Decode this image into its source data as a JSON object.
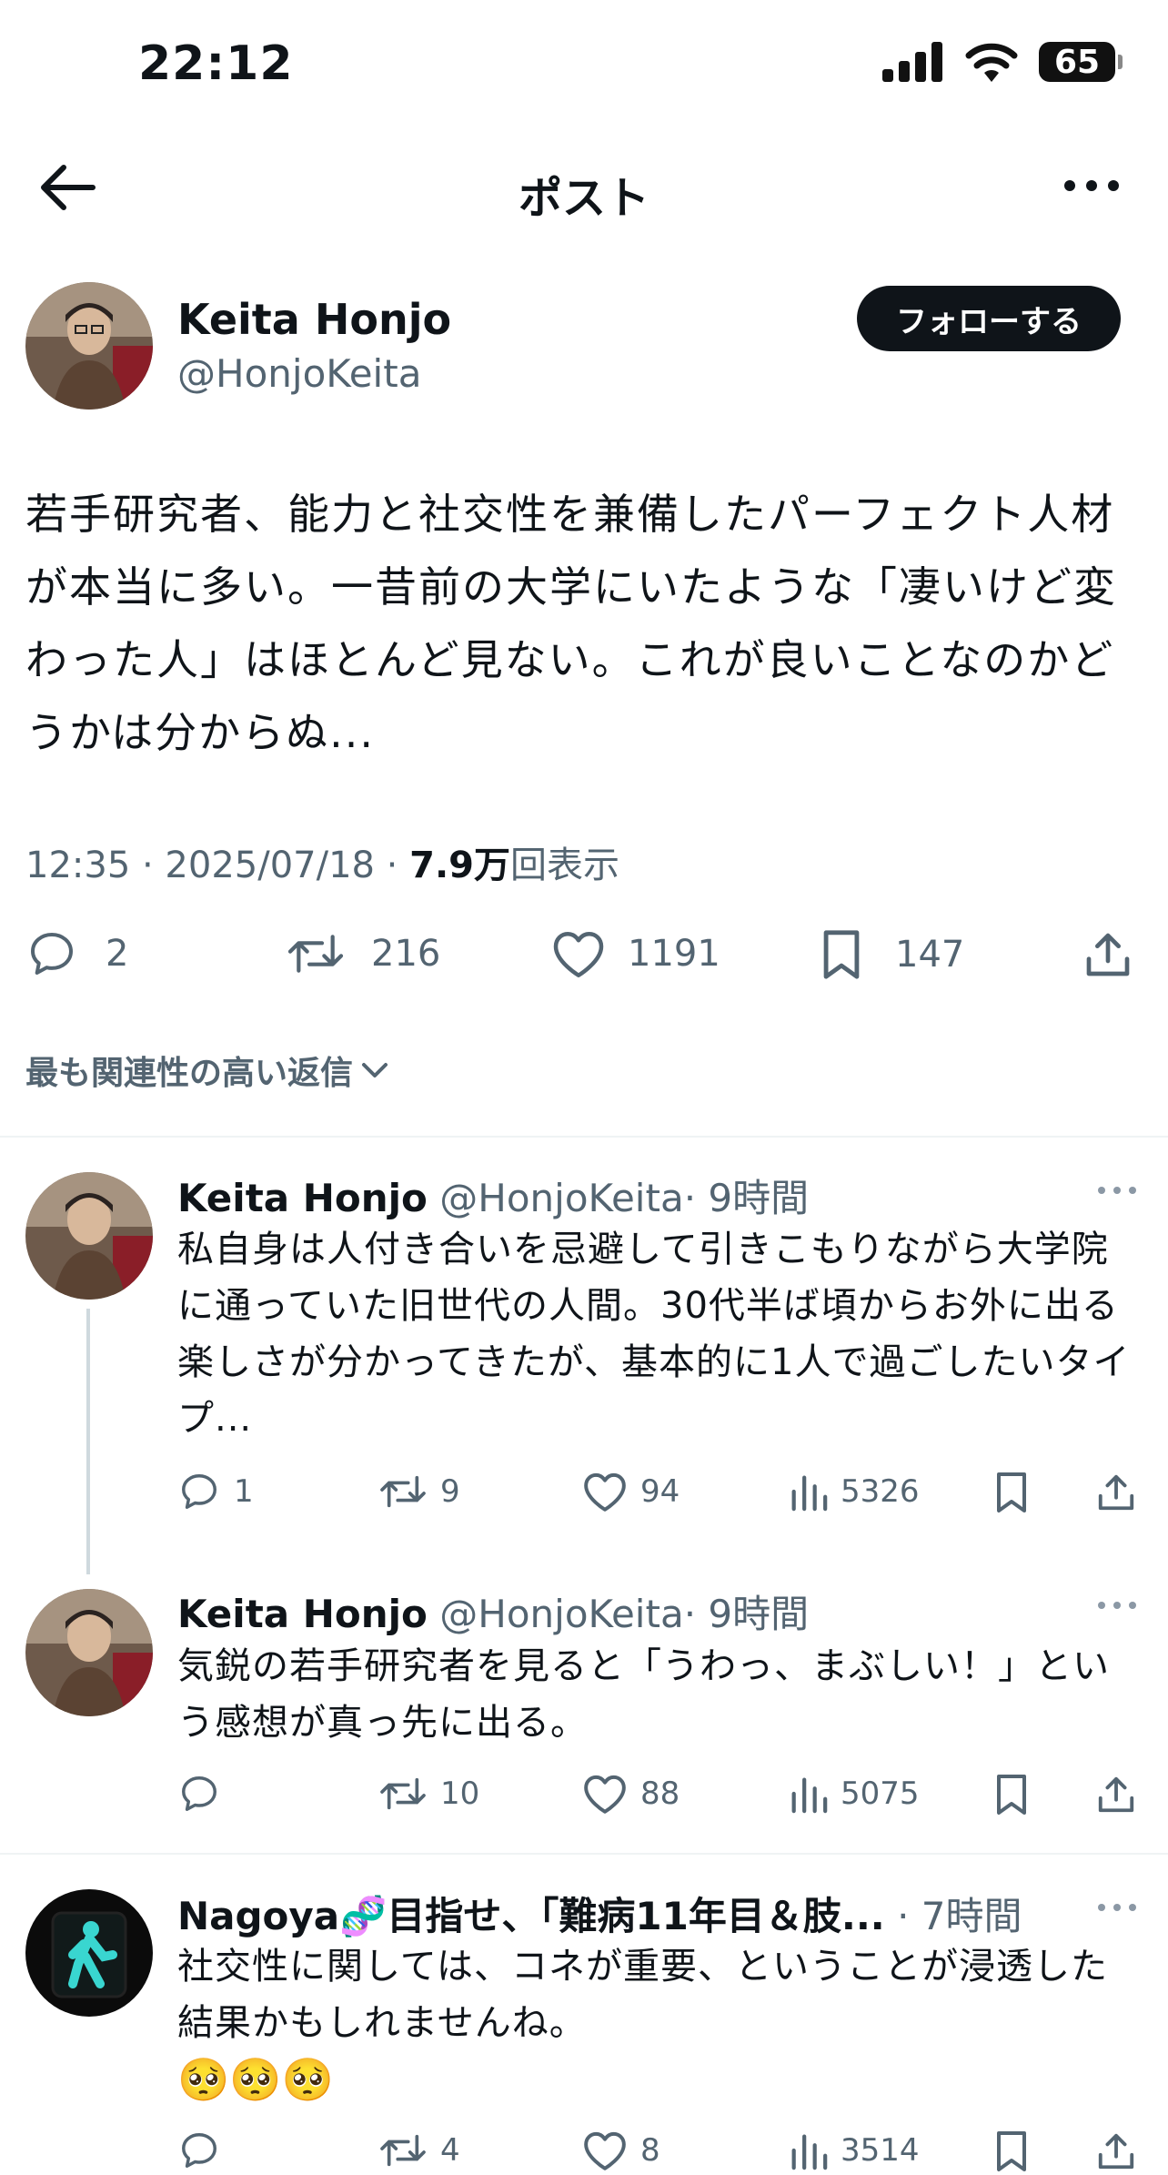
{
  "status_bar": {
    "time": "22:12",
    "battery": "65"
  },
  "header": {
    "title": "ポスト"
  },
  "post": {
    "author_name": "Keita Honjo",
    "author_handle": "@HonjoKeita",
    "follow_label": "フォローする",
    "text": "若手研究者、能力と社交性を兼備したパーフェクト人材が本当に多い。一昔前の大学にいたような「凄いけど変わった人」はほとんど見ない。これが良いことなのかどうかは分からぬ...",
    "time": "12:35 · 2025/07/18 · ",
    "views": "7.9万",
    "views_suffix": "回表示",
    "replies": "2",
    "reposts": "216",
    "likes": "1191",
    "bookmarks": "147"
  },
  "sort": {
    "label": "最も関連性の高い返信"
  },
  "replies": [
    {
      "name": "Keita Honjo",
      "handle": "@HonjoKeita",
      "time": "· 9時間",
      "text": "私自身は人付き合いを忌避して引きこもりながら大学院に通っていた旧世代の人間。30代半ば頃からお外に出る楽しさが分かってきたが、基本的に1人で過ごしたいタイプ...",
      "replies": "1",
      "reposts": "9",
      "likes": "94",
      "views": "5326"
    },
    {
      "name": "Keita Honjo",
      "handle": "@HonjoKeita",
      "time": "· 9時間",
      "text": "気鋭の若手研究者を見ると「うわっ、まぶしい！」という感想が真っ先に出る。",
      "replies": "",
      "reposts": "10",
      "likes": "88",
      "views": "5075"
    },
    {
      "name": "Nagoya🧬目指せ、｢難病11年目＆肢...",
      "handle": "",
      "time": "· 7時間",
      "text": "社交性に関しては、コネが重要、ということが浸透した結果かもしれませんね。",
      "emojis": "🥺🥺🥺",
      "replies": "",
      "reposts": "4",
      "likes": "8",
      "views": "3514"
    }
  ]
}
